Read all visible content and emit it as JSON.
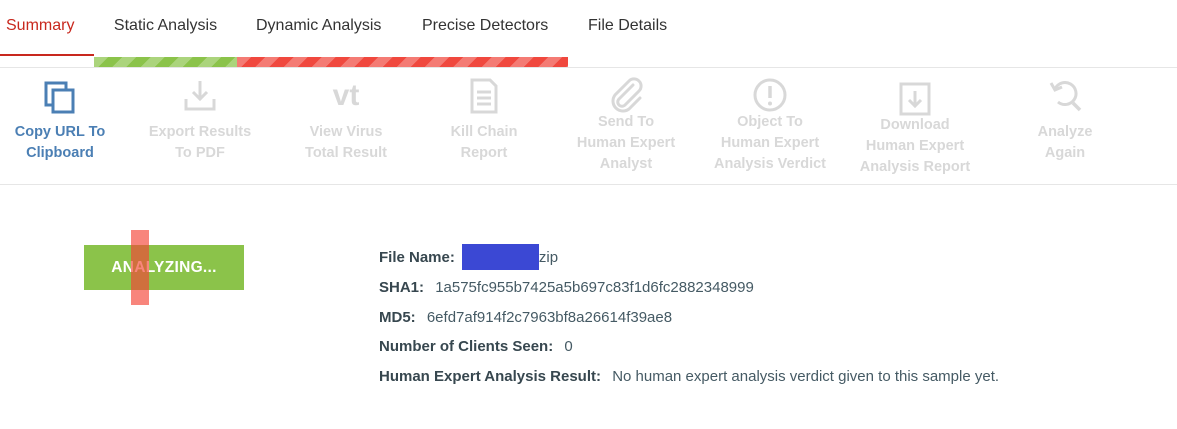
{
  "tabs": [
    {
      "label": "Summary",
      "active": true
    },
    {
      "label": "Static Analysis",
      "active": false
    },
    {
      "label": "Dynamic Analysis",
      "active": false
    },
    {
      "label": "Precise Detectors",
      "active": false
    },
    {
      "label": "File Details",
      "active": false
    }
  ],
  "progress": {
    "static_status_color": "#8bc34a",
    "dynamic_status_color": "#f0483e"
  },
  "toolbar": {
    "items": [
      {
        "label": "Copy URL To\nClipboard",
        "icon": "copy-icon",
        "enabled": true
      },
      {
        "label": "Export Results\nTo PDF",
        "icon": "download-icon",
        "enabled": false
      },
      {
        "label": "View Virus\nTotal Result",
        "icon": "virustotal-icon",
        "enabled": false
      },
      {
        "label": "Kill Chain\nReport",
        "icon": "document-icon",
        "enabled": false
      },
      {
        "label": "Send To\nHuman Expert\nAnalyst",
        "icon": "paperclip-icon",
        "enabled": false
      },
      {
        "label": "Object To\nHuman Expert\nAnalysis Verdict",
        "icon": "exclamation-icon",
        "enabled": false
      },
      {
        "label": "Download\nHuman Expert\nAnalysis Report",
        "icon": "download-report-icon",
        "enabled": false
      },
      {
        "label": "Analyze\nAgain",
        "icon": "reanalyze-icon",
        "enabled": false
      }
    ],
    "vt_glyph": "vt"
  },
  "status": {
    "label": "ANALYZING..."
  },
  "details": {
    "file_name_label": "File Name:",
    "file_name_value": "zip",
    "sha1_label": "SHA1:",
    "sha1_value": "1a575fc955b7425a5b697c83f1d6fc2882348999",
    "md5_label": "MD5:",
    "md5_value": "6efd7af914f2c7963bf8a26614f39ae8",
    "clients_label": "Number of Clients Seen:",
    "clients_value": "0",
    "human_label": "Human Expert Analysis Result:",
    "human_value": "No human expert analysis verdict given to this sample yet."
  },
  "colors": {
    "accent": "#c8281e",
    "link_blue": "#4b7fb4",
    "disabled": "#d8d8d8",
    "badge_green": "#8bc34a",
    "redaction": "#3b48d4"
  }
}
